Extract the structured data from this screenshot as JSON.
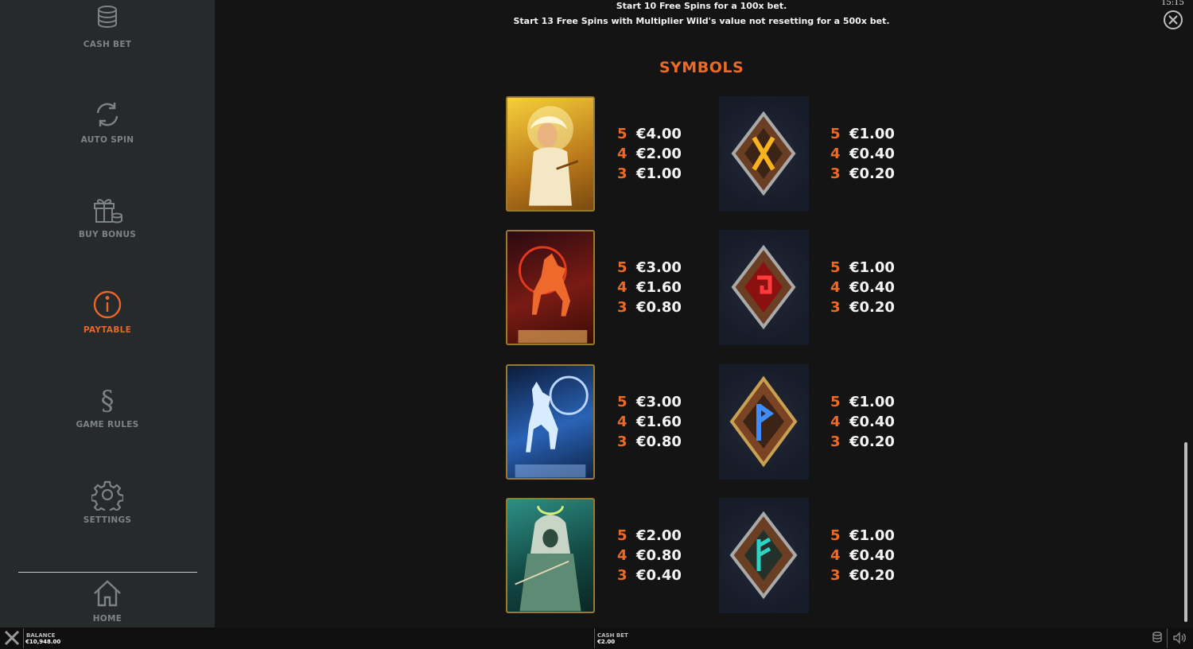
{
  "sidebar": {
    "items": [
      {
        "label": "CASH BET",
        "icon": "coin-stack-icon"
      },
      {
        "label": "AUTO SPIN",
        "icon": "refresh-icon"
      },
      {
        "label": "BUY BONUS",
        "icon": "gift-coins-icon"
      },
      {
        "label": "PAYTABLE",
        "icon": "info-icon",
        "active": true
      },
      {
        "label": "GAME RULES",
        "icon": "section-icon"
      },
      {
        "label": "SETTINGS",
        "icon": "gear-icon"
      },
      {
        "label": "HOME",
        "icon": "home-icon"
      }
    ]
  },
  "header": {
    "line1": "Start 10 Free Spins for a 100x bet.",
    "line2": "Start 13 Free Spins with Multiplier Wild's value not resetting for a 500x bet.",
    "clock": "15:15"
  },
  "paytable": {
    "title": "SYMBOLS",
    "left": [
      {
        "symbol": "golden-goddess",
        "payouts": [
          {
            "count": "5",
            "value": "€4.00"
          },
          {
            "count": "4",
            "value": "€2.00"
          },
          {
            "count": "3",
            "value": "€1.00"
          }
        ]
      },
      {
        "symbol": "fire-wolf",
        "payouts": [
          {
            "count": "5",
            "value": "€3.00"
          },
          {
            "count": "4",
            "value": "€1.60"
          },
          {
            "count": "3",
            "value": "€0.80"
          }
        ]
      },
      {
        "symbol": "ice-wolf",
        "payouts": [
          {
            "count": "5",
            "value": "€3.00"
          },
          {
            "count": "4",
            "value": "€1.60"
          },
          {
            "count": "3",
            "value": "€0.80"
          }
        ]
      },
      {
        "symbol": "hooded-archer",
        "payouts": [
          {
            "count": "5",
            "value": "€2.00"
          },
          {
            "count": "4",
            "value": "€0.80"
          },
          {
            "count": "3",
            "value": "€0.40"
          }
        ]
      }
    ],
    "right": [
      {
        "symbol": "rune-gold",
        "payouts": [
          {
            "count": "5",
            "value": "€1.00"
          },
          {
            "count": "4",
            "value": "€0.40"
          },
          {
            "count": "3",
            "value": "€0.20"
          }
        ]
      },
      {
        "symbol": "rune-red",
        "payouts": [
          {
            "count": "5",
            "value": "€1.00"
          },
          {
            "count": "4",
            "value": "€0.40"
          },
          {
            "count": "3",
            "value": "€0.20"
          }
        ]
      },
      {
        "symbol": "rune-blue",
        "payouts": [
          {
            "count": "5",
            "value": "€1.00"
          },
          {
            "count": "4",
            "value": "€0.40"
          },
          {
            "count": "3",
            "value": "€0.20"
          }
        ]
      },
      {
        "symbol": "rune-teal",
        "payouts": [
          {
            "count": "5",
            "value": "€1.00"
          },
          {
            "count": "4",
            "value": "€0.40"
          },
          {
            "count": "3",
            "value": "€0.20"
          }
        ]
      }
    ]
  },
  "bottombar": {
    "balance_label": "BALANCE",
    "balance_value": "€10,948.00",
    "cashbet_label": "CASH BET",
    "cashbet_value": "€2.00"
  },
  "colors": {
    "accent": "#ee6a24",
    "sidebar": "#262a2b",
    "background": "#141414"
  }
}
